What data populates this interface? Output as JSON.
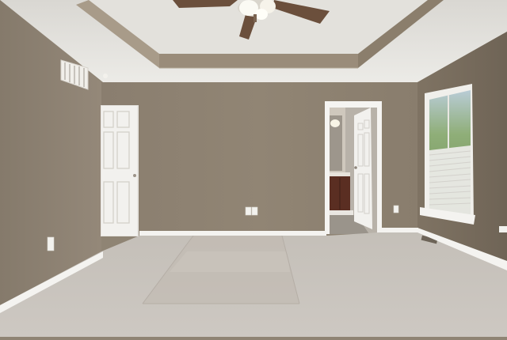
{
  "photo": {
    "icons": {
      "ceiling_fan": "ceiling-fan-icon",
      "air_vent": "air-vent-icon",
      "window": "window-icon",
      "power_outlet": "power-outlet-icon"
    },
    "colors": {
      "wall": "#8b7e6e",
      "wall_shadow": "#7a6e60",
      "ceiling": "#e6e4df",
      "tray_band": "#9a8c7a",
      "carpet": "#c8c3bd",
      "carpet_shadow": "#bab4ad",
      "trim": "#f4f3f0",
      "door": "#f2f1ee",
      "vanity": "#5a2e22",
      "window_glass": "#9fb68c"
    }
  }
}
